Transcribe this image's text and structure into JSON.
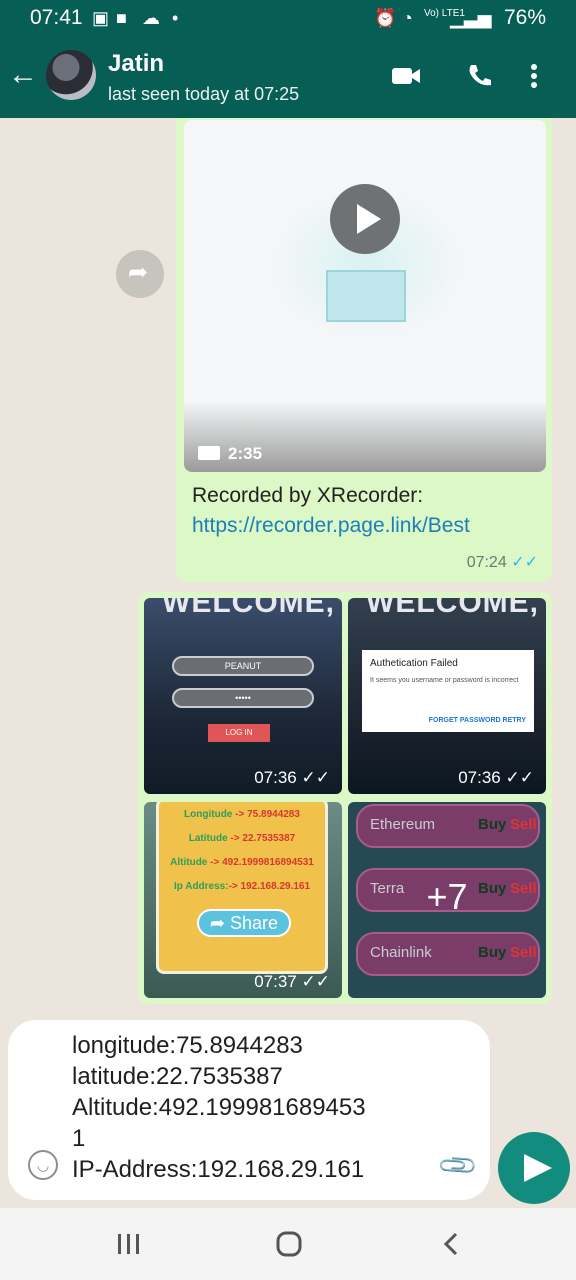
{
  "status_bar": {
    "time": "07:41",
    "network": "Vo) LTE1",
    "battery": "76%"
  },
  "header": {
    "contact_name": "Jatin",
    "last_seen": "last seen today at 07:25"
  },
  "video_message": {
    "duration": "2:35",
    "caption_line1": "Recorded by XRecorder:",
    "caption_link": "https://recorder.page.link/Best",
    "time": "07:24"
  },
  "media_album": {
    "tiles": [
      {
        "welcome": "WELCOME,",
        "field1": "PEANUT",
        "field2": "•••••",
        "button": "LOG IN",
        "time": "07:36"
      },
      {
        "welcome": "WELCOME,",
        "dialog_title": "Authetication Failed",
        "dialog_msg": "It seems you username or password is incorrect",
        "dialog_actions": "FORGET PASSWORD   RETRY",
        "time": "07:36"
      },
      {
        "lines": [
          {
            "key": "Longitude",
            "val": " -> 75.8944283"
          },
          {
            "key": "Latitude",
            "val": " -> 22.7535387"
          },
          {
            "key": "Altitude",
            "val": " -> 492.1999816894531"
          },
          {
            "key": "Ip Address:",
            "val": "-> 192.168.29.161"
          }
        ],
        "share_label": "Share",
        "time": "07:37"
      },
      {
        "coins": [
          "Ethereum",
          "Terra",
          "Chainlink"
        ],
        "buy": "Buy",
        "sell": "Sell",
        "more": "+7"
      }
    ]
  },
  "composer": {
    "text": "longitude:75.8944283\nlatitude:22.7535387\nAltitude:492.199981689453\n1\nIP-Address:192.168.29.161"
  }
}
